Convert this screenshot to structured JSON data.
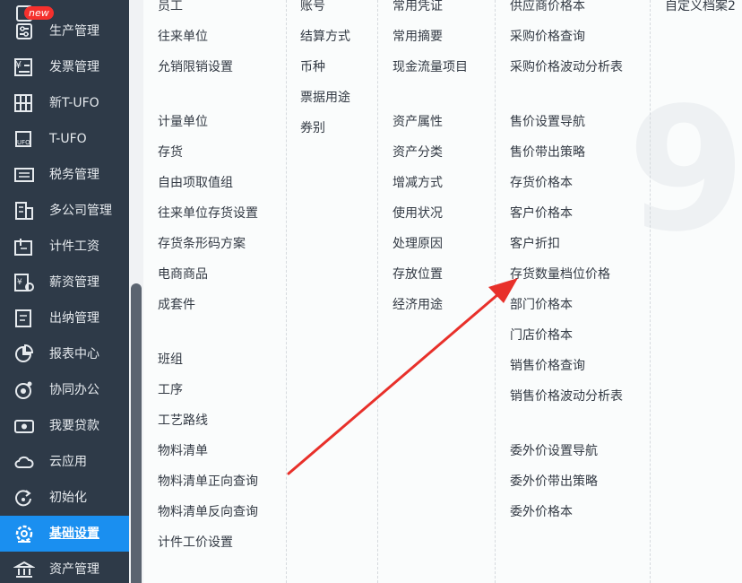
{
  "sidebar": {
    "items": [
      {
        "label": "",
        "icon": "module-icon",
        "badge": "new"
      },
      {
        "label": "生产管理",
        "icon": "production-icon"
      },
      {
        "label": "发票管理",
        "icon": "invoice-icon"
      },
      {
        "label": "新T-UFO",
        "icon": "new-tufo-icon"
      },
      {
        "label": "T-UFO",
        "icon": "tufo-icon"
      },
      {
        "label": "税务管理",
        "icon": "tax-icon"
      },
      {
        "label": "多公司管理",
        "icon": "multi-company-icon"
      },
      {
        "label": "计件工资",
        "icon": "piece-wage-icon"
      },
      {
        "label": "薪资管理",
        "icon": "salary-icon"
      },
      {
        "label": "出纳管理",
        "icon": "cashier-icon"
      },
      {
        "label": "报表中心",
        "icon": "report-icon"
      },
      {
        "label": "协同办公",
        "icon": "collaboration-icon"
      },
      {
        "label": "我要贷款",
        "icon": "loan-icon"
      },
      {
        "label": "云应用",
        "icon": "cloud-icon"
      },
      {
        "label": "初始化",
        "icon": "init-icon"
      },
      {
        "label": "基础设置",
        "icon": "settings-icon",
        "active": true
      },
      {
        "label": "资产管理",
        "icon": "asset-icon"
      }
    ]
  },
  "menu": {
    "col1": [
      "员工",
      "往来单位",
      "允销限销设置",
      "计量单位",
      "存货",
      "自由项取值组",
      "往来单位存货设置",
      "存货条形码方案",
      "电商商品",
      "成套件",
      "班组",
      "工序",
      "工艺路线",
      "物料清单",
      "物料清单正向查询",
      "物料清单反向查询",
      "计件工价设置"
    ],
    "col2": [
      "账号",
      "结算方式",
      "币种",
      "票据用途",
      "券别"
    ],
    "col3": [
      "常用凭证",
      "常用摘要",
      "现金流量项目",
      "资产属性",
      "资产分类",
      "增减方式",
      "使用状况",
      "处理原因",
      "存放位置",
      "经济用途"
    ],
    "col4": [
      "供应商价格本",
      "采购价格查询",
      "采购价格波动分析表",
      "售价设置导航",
      "售价带出策略",
      "存货价格本",
      "客户价格本",
      "客户折扣",
      "存货数量档位价格",
      "部门价格本",
      "门店价格本",
      "销售价格查询",
      "销售价格波动分析表",
      "委外价设置导航",
      "委外价带出策略",
      "委外价格本"
    ],
    "col5": [
      "自定义档案2"
    ]
  },
  "colors": {
    "sidebar_bg": "#2e3a48",
    "active_bg": "#1a8ff0",
    "badge_bg": "#f5302d",
    "arrow": "#e8302a"
  }
}
